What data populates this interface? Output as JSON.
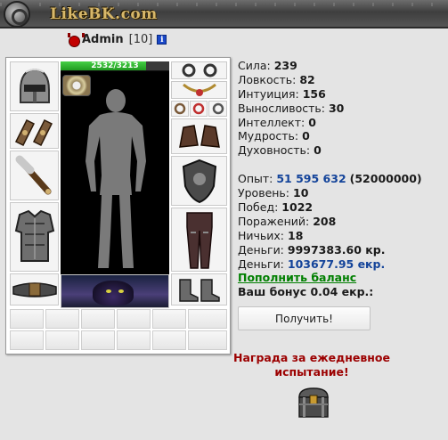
{
  "site": {
    "logo_text": "LikeBK.com"
  },
  "user": {
    "login": "Admin",
    "level": "[10]",
    "info_label": "i"
  },
  "character": {
    "hp_text": "2532/3213",
    "hp_fraction": 0.788
  },
  "stats": [
    {
      "label": "Сила:",
      "value": "239"
    },
    {
      "label": "Ловкость:",
      "value": "82"
    },
    {
      "label": "Интуиция:",
      "value": "156"
    },
    {
      "label": "Выносливость:",
      "value": "30"
    },
    {
      "label": "Интеллект:",
      "value": "0"
    },
    {
      "label": "Мудрость:",
      "value": "0"
    },
    {
      "label": "Духовность:",
      "value": "0"
    }
  ],
  "progress": {
    "exp_label": "Опыт:",
    "exp_value": "51 595 632",
    "exp_next": "(52000000)",
    "level_label": "Уровень:",
    "level_value": "10",
    "wins_label": "Побед:",
    "wins_value": "1022",
    "losses_label": "Поражений:",
    "losses_value": "208",
    "draws_label": "Ничьих:",
    "draws_value": "18",
    "money_label": "Деньги:",
    "money_value": "9997383.60 кр.",
    "ekr_label": "Деньги:",
    "ekr_value": "103677.95 екр."
  },
  "balance": {
    "topup_link": "Пополнить баланс",
    "bonus_label": "Ваш бонус 0.04 екр.:",
    "get_button": "Получить!"
  },
  "daily": {
    "reward_title": "Награда за ежедневное испытание!"
  },
  "colors": {
    "hp_bar": "#2fb02f",
    "link_green": "#007f00",
    "value_blue": "#14449a",
    "reward_red": "#9c0000"
  }
}
